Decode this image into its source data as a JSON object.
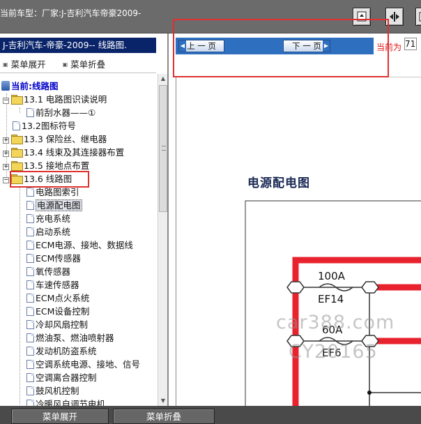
{
  "header": {
    "title": "当前车型：厂家:J-吉利汽车帝豪2009-",
    "icons": [
      "window-restore-icon",
      "split-view-icon",
      "window-icon"
    ]
  },
  "sidebar": {
    "title": "J-吉利汽车-帝豪-2009-- 线路图.",
    "expand_all": "菜单展开",
    "collapse_all": "菜单折叠",
    "root_label": "当前:线路图",
    "items": [
      {
        "label": "13.1 电路图识读说明",
        "type": "folder",
        "expanded": true
      },
      {
        "label": "前刮水器——①",
        "type": "page"
      },
      {
        "label": "13.2图标符号",
        "type": "page"
      },
      {
        "label": "13.3 保险丝、继电器",
        "type": "folder"
      },
      {
        "label": "13.4 线束及其连接器布置",
        "type": "folder"
      },
      {
        "label": "13.5 接地点布置",
        "type": "folder"
      },
      {
        "label": "13.6 线路图",
        "type": "folder",
        "expanded": true
      },
      {
        "label": "电路图索引",
        "type": "page"
      },
      {
        "label": "电源配电图",
        "type": "page",
        "selected": true
      },
      {
        "label": "充电系统",
        "type": "page"
      },
      {
        "label": "启动系统",
        "type": "page"
      },
      {
        "label": "ECM电源、接地、数据线",
        "type": "page"
      },
      {
        "label": "ECM传感器",
        "type": "page"
      },
      {
        "label": "氧传感器",
        "type": "page"
      },
      {
        "label": "车速传感器",
        "type": "page"
      },
      {
        "label": "ECM点火系统",
        "type": "page"
      },
      {
        "label": "ECM设备控制",
        "type": "page"
      },
      {
        "label": "冷却风扇控制",
        "type": "page"
      },
      {
        "label": "燃油泵、燃油喷射器",
        "type": "page"
      },
      {
        "label": "发动机防盗系统",
        "type": "page"
      },
      {
        "label": "空调系统电源、接地、信号",
        "type": "page"
      },
      {
        "label": "空调离合器控制",
        "type": "page"
      },
      {
        "label": "鼓风机控制",
        "type": "page"
      },
      {
        "label": "冷暖风自调节电机",
        "type": "page"
      }
    ]
  },
  "viewer": {
    "prev_label": "上 一 页",
    "next_label": "下 一 页",
    "current_label": "当前为",
    "current_page": "71",
    "doc_title": "电源配电图",
    "fuse1_rating": "100A",
    "fuse1_id": "EF14",
    "fuse2_rating": "60A",
    "fuse2_id": "EF6",
    "wire_color": "#e8232e"
  },
  "watermark": {
    "line1": "car388.com",
    "line2": "CY20165"
  },
  "footer": {
    "expand_label": "菜单展开",
    "collapse_label": "菜单折叠"
  }
}
